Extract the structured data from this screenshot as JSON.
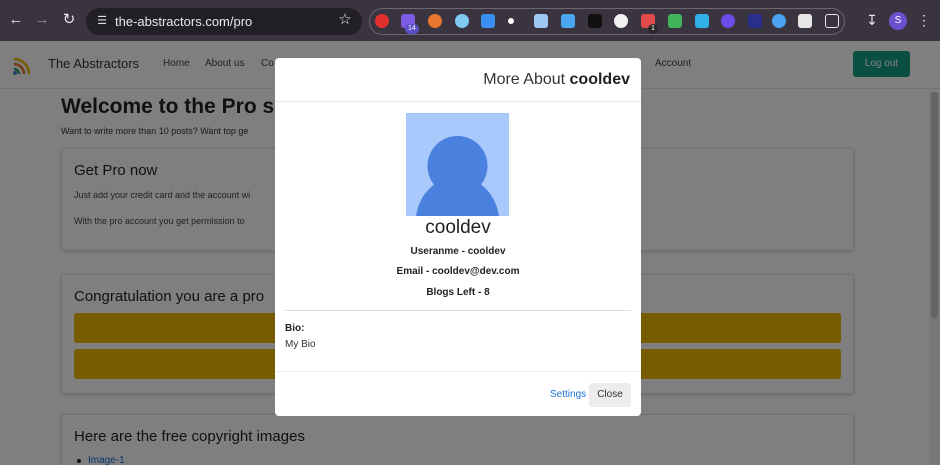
{
  "browser": {
    "url": "the-abstractors.com/pro",
    "extension_badge_1": "14",
    "extension_badge_2": "1",
    "profile_initial": "S",
    "icons": [
      "back-arrow-icon",
      "forward-arrow-icon",
      "reload-icon",
      "site-settings-icon",
      "bookmark-star-icon",
      "downloads-icon",
      "more-menu-icon"
    ]
  },
  "site": {
    "brand": "The Abstractors",
    "nav": [
      "Home",
      "About us",
      "Co",
      "Account"
    ],
    "logout": "Log out"
  },
  "page": {
    "welcome": "Welcome to the Pro se",
    "welcome_sub": "Want to write more than 10 posts? Want top ge",
    "get_pro": {
      "title": "Get Pro now",
      "line1": "Just add your credit card and the account wi",
      "line2": "With the pro account you get permission to"
    },
    "congrats_title": "Congratulation you are a pro",
    "images_title": "Here are the free copyright images",
    "images_link": "Image-1"
  },
  "modal": {
    "title_prefix": "More About",
    "title_user": "cooldev",
    "name": "cooldev",
    "username": "Useranme - cooldev",
    "email": "Email - cooldev@dev.com",
    "blogs_left": "Blogs Left - 8",
    "bio_label": "Bio:",
    "bio": "My Bio",
    "settings": "Settings",
    "close": "Close"
  },
  "colors": {
    "accent_green": "#159e82",
    "bar_yellow": "#f0b400",
    "link_blue": "#1a73d6",
    "avatar_bg": "#a9c8fc",
    "avatar_fg": "#4a80de"
  }
}
